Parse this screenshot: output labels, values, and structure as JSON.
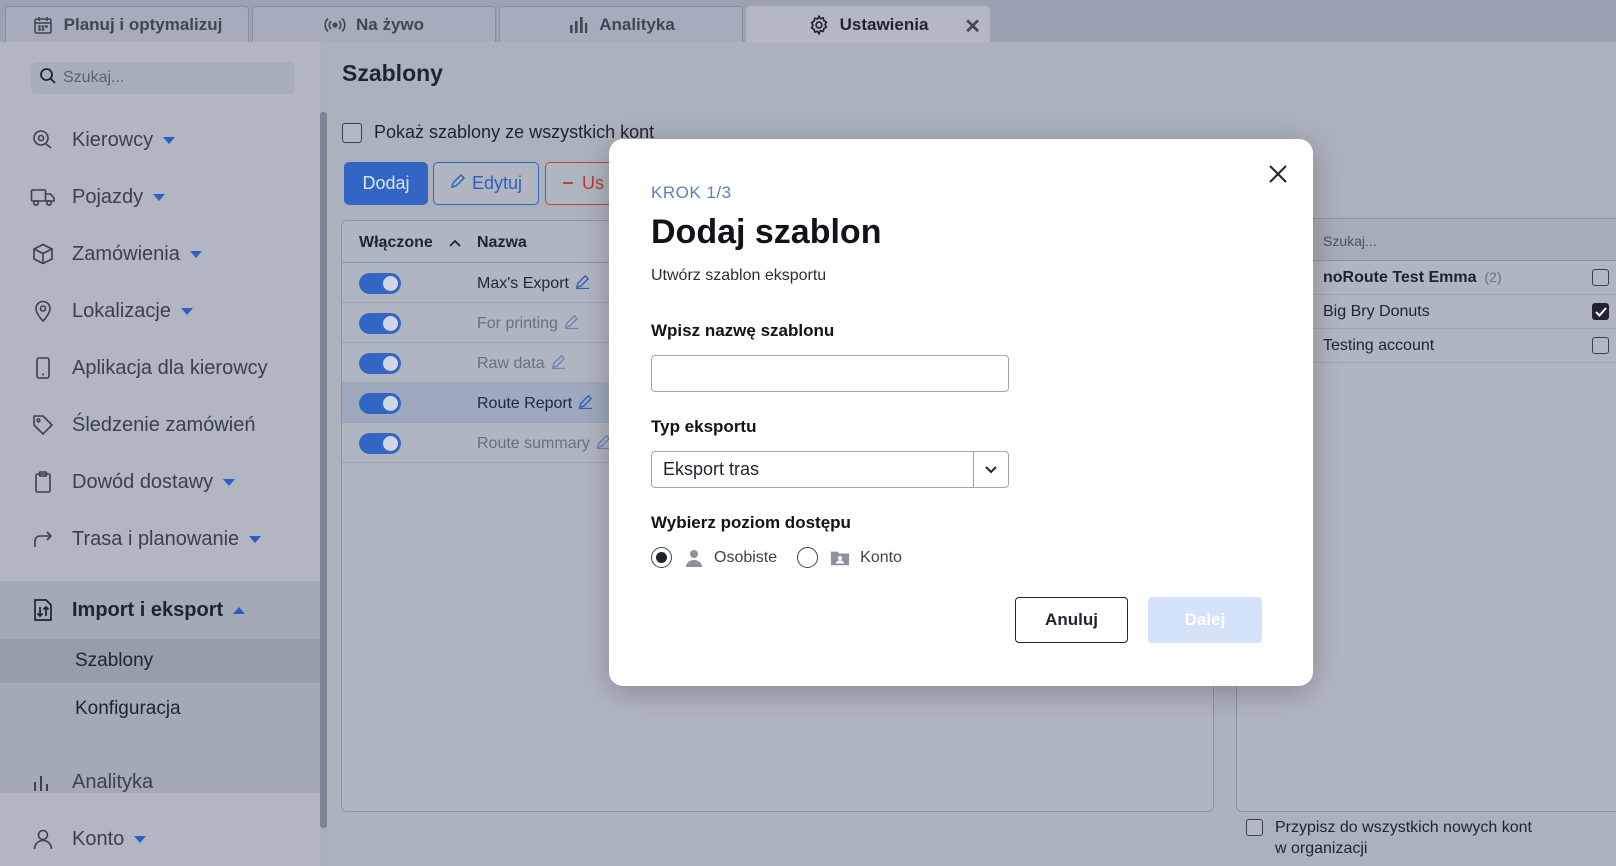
{
  "tabs": [
    {
      "label": "Planuj i optymalizuj",
      "icon": "calendar-icon"
    },
    {
      "label": "Na żywo",
      "icon": "broadcast-icon"
    },
    {
      "label": "Analityka",
      "icon": "bar-chart-icon"
    },
    {
      "label": "Ustawienia",
      "icon": "gear-icon",
      "active": true
    }
  ],
  "tab_close_glyph": "✕",
  "sidebar": {
    "search_placeholder": "Szukaj...",
    "items": [
      {
        "label": "Kierowcy",
        "icon": "driver-icon",
        "caret": "down"
      },
      {
        "label": "Pojazdy",
        "icon": "truck-icon",
        "caret": "down"
      },
      {
        "label": "Zamówienia",
        "icon": "box-icon",
        "caret": "down"
      },
      {
        "label": "Lokalizacje",
        "icon": "location-pin-icon",
        "caret": "down"
      },
      {
        "label": "Aplikacja dla kierowcy",
        "icon": "phone-icon"
      },
      {
        "label": "Śledzenie zamówień",
        "icon": "tag-icon"
      },
      {
        "label": "Dowód dostawy",
        "icon": "clipboard-icon",
        "caret": "down"
      },
      {
        "label": "Trasa i planowanie",
        "icon": "route-arrow-icon",
        "caret": "down"
      },
      {
        "label": "Import i eksport",
        "icon": "import-export-icon",
        "caret": "up",
        "open": true
      },
      {
        "label": "Analityka",
        "icon": "bar-chart-icon"
      },
      {
        "label": "Konto",
        "icon": "user-icon",
        "caret": "down"
      }
    ],
    "subitems": [
      {
        "label": "Szablony",
        "active": true
      },
      {
        "label": "Konfiguracja"
      }
    ]
  },
  "main": {
    "title": "Szablony",
    "show_all_label": "Pokaż szablony ze wszystkich kont",
    "buttons": {
      "add": "Dodaj",
      "edit": "Edytuj",
      "delete": "Us"
    },
    "table": {
      "headers": {
        "enabled": "Włączone",
        "name": "Nazwa"
      },
      "rows": [
        {
          "name": "Max's Export",
          "enabled": true
        },
        {
          "name": "For printing",
          "enabled": true
        },
        {
          "name": "Raw data",
          "enabled": true
        },
        {
          "name": "Route Report",
          "enabled": true,
          "selected": true
        },
        {
          "name": "Route summary",
          "enabled": true
        }
      ]
    },
    "accounts": {
      "search_placeholder": "Szukaj...",
      "rows": [
        {
          "name": "noRoute Test Emma",
          "count": "(2)",
          "checked": false,
          "bold": true
        },
        {
          "name": "Big Bry Donuts",
          "checked": true
        },
        {
          "name": "Testing account",
          "checked": false
        }
      ],
      "assign_all_line1": "Przypisz do wszystkich nowych kont",
      "assign_all_line2": "w organizacji"
    }
  },
  "modal": {
    "step": "KROK 1/3",
    "title": "Dodaj szablon",
    "subtitle": "Utwórz szablon eksportu",
    "name_label": "Wpisz nazwę szablonu",
    "name_value": "",
    "type_label": "Typ eksportu",
    "type_value": "Eksport tras",
    "access_label": "Wybierz poziom dostępu",
    "access_options": [
      {
        "label": "Osobiste",
        "icon": "person-icon",
        "selected": true
      },
      {
        "label": "Konto",
        "icon": "folder-user-icon",
        "selected": false
      }
    ],
    "cancel_label": "Anuluj",
    "next_label": "Dalej"
  }
}
